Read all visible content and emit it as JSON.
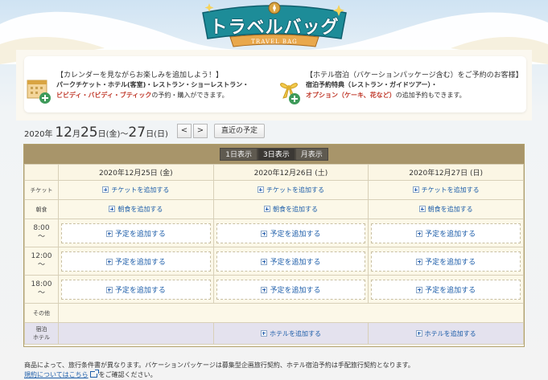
{
  "header": {
    "logo_title": "トラベルバッグ",
    "logo_subtitle": "TRAVEL BAG"
  },
  "promo_calendar": {
    "heading": "【カレンダーを見ながらお楽しみを追加しよう！】",
    "line1": "パークチケット・ホテル(客室)・レストラン・ショーレストラン・",
    "line2_red": "ビビディ・バビディ・ブティック",
    "line2_rest": "の予約・購入ができます。"
  },
  "promo_hotel": {
    "heading": "【ホテル宿泊（バケーションパッケージ含む）をご予約のお客様】",
    "line1": "宿泊予約特典（レストラン・ガイドツアー）・",
    "line2_red": "オプション（ケーキ、花など）",
    "line2_rest": "の追加予約もできます。"
  },
  "date_range": {
    "year": "2020",
    "year_unit": "年",
    "month1": "12",
    "month_unit1": "月",
    "day1": "25",
    "day_unit1": "日",
    "weekday1": "(金)",
    "tilde": "～",
    "day2": "27",
    "day_unit2": "日",
    "weekday2": "(日)"
  },
  "nav": {
    "prev": "<",
    "next": ">",
    "recent": "直近の予定"
  },
  "view_tabs": {
    "day1": "1日表示",
    "day3": "3日表示",
    "month": "月表示",
    "active": "3日表示"
  },
  "columns": [
    "2020年12月25日 (金)",
    "2020年12月26日 (土)",
    "2020年12月27日 (日)"
  ],
  "rows": {
    "ticket": "チケット",
    "breakfast": "朝食",
    "time1a": "8:00",
    "time1b": "～",
    "time2a": "12:00",
    "time2b": "～",
    "time3a": "18:00",
    "time3b": "～",
    "other": "その他",
    "hotel_a": "宿泊",
    "hotel_b": "ホテル"
  },
  "actions": {
    "add_ticket": "チケットを追加する",
    "add_breakfast": "朝食を追加する",
    "add_plan": "予定を追加する",
    "add_hotel": "ホテルを追加する"
  },
  "footer": {
    "line1": "商品によって、旅行条件書が異なります。バケーションパッケージは募集型企画旅行契約、ホテル宿泊予約は手配旅行契約となります。",
    "terms_link": "規約についてはこちら",
    "line2_rest": "をご確認ください。"
  },
  "colors": {
    "link": "#1f5faa",
    "accent_red": "#c0392b",
    "calendar_header": "#a8956a",
    "hotel_row": "#e4e2ee"
  }
}
